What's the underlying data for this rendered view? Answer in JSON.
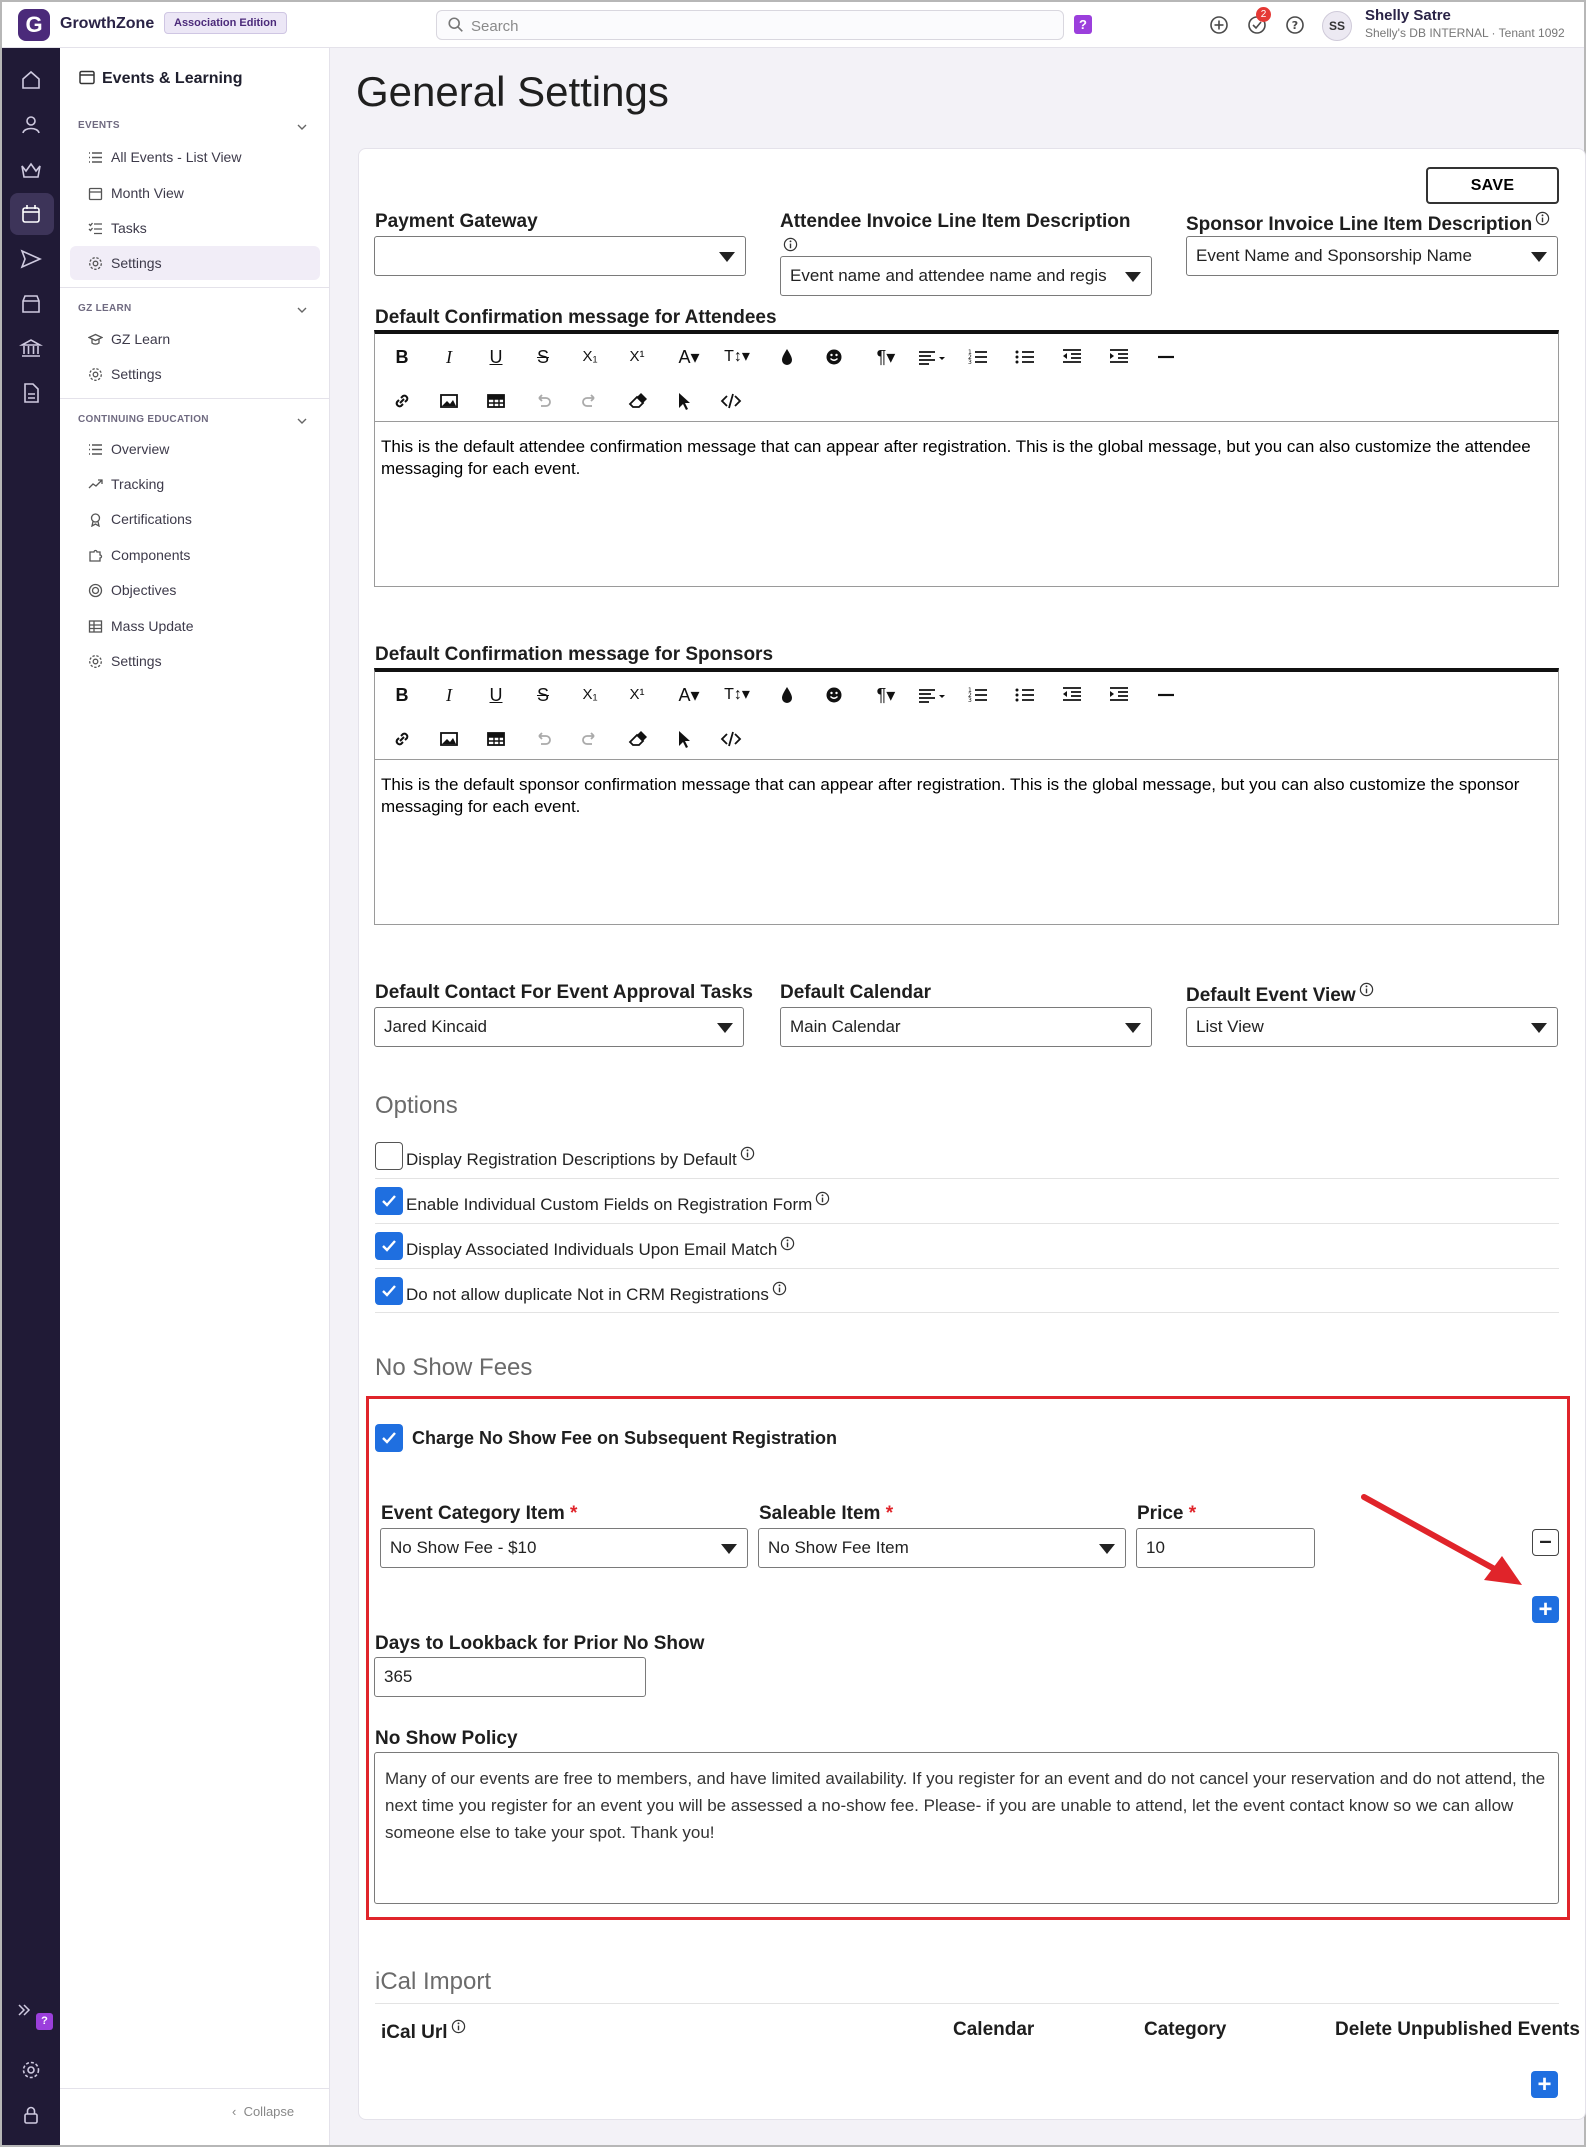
{
  "app": {
    "logo_letter": "G",
    "name": "GrowthZone",
    "edition": "Association Edition",
    "search_placeholder": "Search",
    "help_badge": "?",
    "notification_count": "2",
    "user_initials": "SS",
    "user_name": "Shelly Satre",
    "user_tenant": "Shelly's DB INTERNAL · Tenant 1092"
  },
  "rail": {
    "icons": [
      "home-icon",
      "person-icon",
      "crown-icon",
      "calendar-icon",
      "send-icon",
      "store-icon",
      "bank-icon",
      "document-icon"
    ],
    "bottom_icons": [
      "expand-icon",
      "settings-icon",
      "lock-icon"
    ],
    "help_badge": "?"
  },
  "nav": {
    "title": "Events & Learning",
    "sections": [
      {
        "label": "EVENTS",
        "items": [
          "All Events - List View",
          "Month View",
          "Tasks",
          "Settings"
        ]
      },
      {
        "label": "GZ LEARN",
        "items": [
          "GZ Learn",
          "Settings"
        ]
      },
      {
        "label": "CONTINUING EDUCATION",
        "items": [
          "Overview",
          "Tracking",
          "Certifications",
          "Components",
          "Objectives",
          "Mass Update",
          "Settings"
        ]
      }
    ],
    "selected_item": "Settings",
    "collapse_label": "Collapse"
  },
  "page": {
    "title": "General Settings",
    "save_label": "SAVE",
    "payment_gateway": {
      "label": "Payment Gateway",
      "value": ""
    },
    "attendee_invoice": {
      "label": "Attendee Invoice Line Item Description",
      "value": "Event name and attendee name and regis"
    },
    "sponsor_invoice": {
      "label": "Sponsor Invoice Line Item Description",
      "value": "Event Name and Sponsorship Name"
    },
    "attendee_message": {
      "label": "Default Confirmation message for Attendees",
      "text": "This is the default attendee confirmation message that can appear after registration. This is the global message, but you can also customize the attendee messaging for each event."
    },
    "sponsor_message": {
      "label": "Default Confirmation message for Sponsors",
      "text": "This is the default sponsor confirmation message that can appear after registration. This is the global message, but you can also customize the sponsor messaging for each event."
    },
    "toolbar_buttons": [
      "B",
      "I",
      "U",
      "S",
      "X₁",
      "X¹",
      "A▾",
      "T↕▾",
      "ink",
      "emoji",
      "¶▾",
      "align▾",
      "ol",
      "ul",
      "outdent",
      "indent",
      "—",
      "link",
      "image",
      "table",
      "undo",
      "redo",
      "eraser",
      "pointer",
      "code"
    ],
    "default_contact": {
      "label": "Default Contact For Event Approval Tasks",
      "value": "Jared Kincaid"
    },
    "default_calendar": {
      "label": "Default Calendar",
      "value": "Main Calendar"
    },
    "default_view": {
      "label": "Default Event View",
      "value": "List View"
    },
    "options": {
      "title": "Options",
      "items": [
        {
          "label": "Display Registration Descriptions by Default",
          "checked": false
        },
        {
          "label": "Enable Individual Custom Fields on Registration Form",
          "checked": true
        },
        {
          "label": "Display Associated Individuals Upon Email Match",
          "checked": true
        },
        {
          "label": "Do not allow duplicate Not in CRM Registrations",
          "checked": true
        }
      ]
    },
    "no_show": {
      "title": "No Show Fees",
      "charge_label": "Charge No Show Fee on Subsequent Registration",
      "charge_checked": true,
      "category_label": "Event Category Item",
      "category_value": "No Show Fee - $10",
      "saleable_label": "Saleable Item",
      "saleable_value": "No Show Fee Item",
      "price_label": "Price",
      "price_value": "10",
      "required_mark": "*",
      "lookback_label": "Days to Lookback for Prior No Show",
      "lookback_value": "365",
      "policy_label": "No Show Policy",
      "policy_text": "Many of our events are free to members, and have limited availability. If you register for an event and do not cancel your reservation and do not attend, the next time you register for an event you will be assessed a no-show fee. Please- if you are unable to attend, let the event contact know so we can allow someone else to take your spot. Thank you!"
    },
    "ical": {
      "title": "iCal Import",
      "columns": [
        "iCal Url",
        "Calendar",
        "Category",
        "Delete Unpublished Events"
      ]
    }
  },
  "colors": {
    "accent": "#1f6fe0",
    "highlight": "#e0242a",
    "rail": "#201a36",
    "brand": "#4b2a7a"
  }
}
